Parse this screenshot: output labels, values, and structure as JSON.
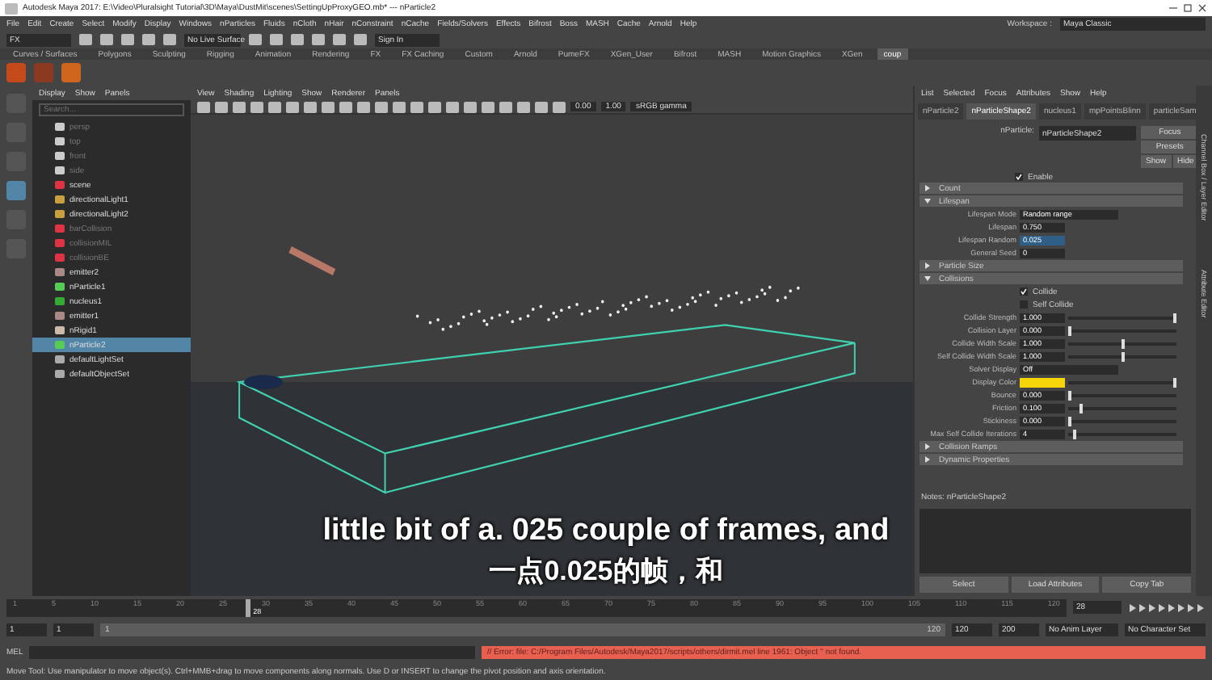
{
  "window": {
    "title": "Autodesk Maya 2017: E:\\Video\\Pluralsight Tutorial\\3D\\Maya\\DustMit\\scenes\\SettingUpProxyGEO.mb*  ---  nParticle2"
  },
  "menu": [
    "File",
    "Edit",
    "Create",
    "Select",
    "Modify",
    "Display",
    "Windows",
    "nParticles",
    "Fluids",
    "nCloth",
    "nHair",
    "nConstraint",
    "nCache",
    "Fields/Solvers",
    "Effects",
    "Bifrost",
    "Boss",
    "MASH",
    "Cache",
    "Arnold",
    "Help"
  ],
  "workspace": {
    "label": "Workspace :",
    "value": "Maya Classic"
  },
  "status_line": {
    "menu_set": "FX",
    "live_surface": "No Live Surface",
    "sign_in": "Sign In"
  },
  "shelf_tabs": [
    {
      "label": "Curves / Surfaces",
      "selected": false
    },
    {
      "label": "Polygons",
      "selected": false
    },
    {
      "label": "Sculpting",
      "selected": false
    },
    {
      "label": "Rigging",
      "selected": false
    },
    {
      "label": "Animation",
      "selected": false
    },
    {
      "label": "Rendering",
      "selected": false
    },
    {
      "label": "FX",
      "selected": false
    },
    {
      "label": "FX Caching",
      "selected": false
    },
    {
      "label": "Custom",
      "selected": false
    },
    {
      "label": "Arnold",
      "selected": false
    },
    {
      "label": "PumeFX",
      "selected": false
    },
    {
      "label": "XGen_User",
      "selected": false
    },
    {
      "label": "Bifrost",
      "selected": false
    },
    {
      "label": "MASH",
      "selected": false
    },
    {
      "label": "Motion Graphics",
      "selected": false
    },
    {
      "label": "XGen",
      "selected": false
    },
    {
      "label": "coup",
      "selected": true
    }
  ],
  "outliner": {
    "menu": [
      "Display",
      "Show",
      "Panels"
    ],
    "search": {
      "placeholder": "Search..."
    },
    "items": [
      {
        "label": "persp",
        "kind": "camera",
        "dimmed": true,
        "selected": false
      },
      {
        "label": "top",
        "kind": "camera",
        "dimmed": true,
        "selected": false
      },
      {
        "label": "front",
        "kind": "camera",
        "dimmed": true,
        "selected": false
      },
      {
        "label": "side",
        "kind": "camera",
        "dimmed": true,
        "selected": false
      },
      {
        "label": "scene",
        "kind": "group",
        "dimmed": false,
        "selected": false
      },
      {
        "label": "directionalLight1",
        "kind": "light",
        "dimmed": false,
        "selected": false
      },
      {
        "label": "directionalLight2",
        "kind": "light",
        "dimmed": false,
        "selected": false
      },
      {
        "label": "barCollision",
        "kind": "group",
        "dimmed": true,
        "selected": false
      },
      {
        "label": "collisionMIL",
        "kind": "group",
        "dimmed": true,
        "selected": false
      },
      {
        "label": "collisionBE",
        "kind": "group",
        "dimmed": true,
        "selected": false
      },
      {
        "label": "emitter2",
        "kind": "emitter",
        "dimmed": false,
        "selected": false
      },
      {
        "label": "nParticle1",
        "kind": "particle",
        "dimmed": false,
        "selected": false
      },
      {
        "label": "nucleus1",
        "kind": "nucleus",
        "dimmed": false,
        "selected": false
      },
      {
        "label": "emitter1",
        "kind": "emitter",
        "dimmed": false,
        "selected": false
      },
      {
        "label": "nRigid1",
        "kind": "rigid",
        "dimmed": false,
        "selected": false
      },
      {
        "label": "nParticle2",
        "kind": "particle",
        "dimmed": false,
        "selected": true
      },
      {
        "label": "defaultLightSet",
        "kind": "set",
        "dimmed": false,
        "selected": false
      },
      {
        "label": "defaultObjectSet",
        "kind": "set",
        "dimmed": false,
        "selected": false
      }
    ]
  },
  "viewport": {
    "menu": [
      "View",
      "Shading",
      "Lighting",
      "Show",
      "Renderer",
      "Panels"
    ],
    "exposure": "0.00",
    "gamma": "1.00",
    "color_space": "sRGB gamma"
  },
  "attribute_editor": {
    "menu": [
      "List",
      "Selected",
      "Focus",
      "Attributes",
      "Show",
      "Help"
    ],
    "tabs": [
      {
        "label": "nParticle2",
        "selected": false
      },
      {
        "label": "nParticleShape2",
        "selected": true
      },
      {
        "label": "nucleus1",
        "selected": false
      },
      {
        "label": "mpPointsBlinn",
        "selected": false
      },
      {
        "label": "particleSam",
        "selected": false
      }
    ],
    "node_label": "nParticle:",
    "node_name": "nParticleShape2",
    "buttons": [
      "Focus",
      "Presets",
      "Show",
      "Hide"
    ],
    "enable": {
      "label": "Enable",
      "checked": true
    },
    "rows": [
      {
        "kind": "section",
        "label": "Count",
        "expanded": false
      },
      {
        "kind": "section",
        "label": "Lifespan",
        "expanded": true
      },
      {
        "kind": "dropdown",
        "label": "Lifespan Mode",
        "value": "Random range"
      },
      {
        "kind": "field",
        "label": "Lifespan",
        "value": "0.750",
        "selected": false
      },
      {
        "kind": "field",
        "label": "Lifespan Random",
        "value": "0.025",
        "selected": true
      },
      {
        "kind": "field",
        "label": "General Seed",
        "value": "0",
        "selected": false
      },
      {
        "kind": "section",
        "label": "Particle Size",
        "expanded": false
      },
      {
        "kind": "section",
        "label": "Collisions",
        "expanded": true
      },
      {
        "kind": "checkbox",
        "label": "Collide",
        "checked": true
      },
      {
        "kind": "checkbox",
        "label": "Self Collide",
        "checked": false
      },
      {
        "kind": "slider",
        "label": "Collide Strength",
        "value": "1.000",
        "level": 1
      },
      {
        "kind": "slider",
        "label": "Collision Layer",
        "value": "0.000",
        "level": 0
      },
      {
        "kind": "slider",
        "label": "Collide Width Scale",
        "value": "1.000",
        "level": 0.5
      },
      {
        "kind": "slider",
        "label": "Self Collide Width Scale",
        "value": "1.000",
        "level": 0.5
      },
      {
        "kind": "dropdown",
        "label": "Solver Display",
        "value": "Off"
      },
      {
        "kind": "color",
        "label": "Display Color",
        "color": "#f5d60a"
      },
      {
        "kind": "slider",
        "label": "Bounce",
        "value": "0.000",
        "level": 0
      },
      {
        "kind": "slider",
        "label": "Friction",
        "value": "0.100",
        "level": 0.1
      },
      {
        "kind": "slider",
        "label": "Stickiness",
        "value": "0.000",
        "level": 0
      },
      {
        "kind": "slider",
        "label": "Max Self Collide Iterations",
        "value": "4",
        "level": 0.04
      },
      {
        "kind": "section",
        "label": "Collision Ramps",
        "expanded": false
      },
      {
        "kind": "section",
        "label": "Dynamic Properties",
        "expanded": false
      }
    ],
    "notes_label": "Notes:  nParticleShape2",
    "bottom_buttons": [
      "Select",
      "Load Attributes",
      "Copy Tab"
    ]
  },
  "side_tabs": [
    "Channel Box / Layer Editor",
    "Attribute Editor"
  ],
  "time_slider": {
    "ticks": [
      "1",
      "5",
      "10",
      "15",
      "20",
      "25",
      "30",
      "35",
      "40",
      "45",
      "50",
      "55",
      "60",
      "65",
      "70",
      "75",
      "80",
      "85",
      "90",
      "95",
      "100",
      "105",
      "110",
      "115",
      "120"
    ],
    "current": "28",
    "level": 0.225,
    "current_frame": "28"
  },
  "range_slider": {
    "level": 1,
    "start": "1",
    "playback_start": "1",
    "range_start": "1",
    "range_end": "120",
    "playback_end": "120",
    "end": "200",
    "anim_layer": "No Anim Layer",
    "character_set": "No Character Set"
  },
  "command_line": {
    "label": "MEL",
    "error": "// Error: file: C:/Program Files/Autodesk/Maya2017/scripts/others/dirmit.mel line 1961: Object '' not found."
  },
  "help_line": "Move Tool: Use manipulator to move object(s). Ctrl+MMB+drag to move components along normals. Use D or INSERT to change the pivot position and axis orientation.",
  "subtitles": [
    "little bit of a. 025 couple of frames, and",
    "一点0.025的帧，和"
  ]
}
